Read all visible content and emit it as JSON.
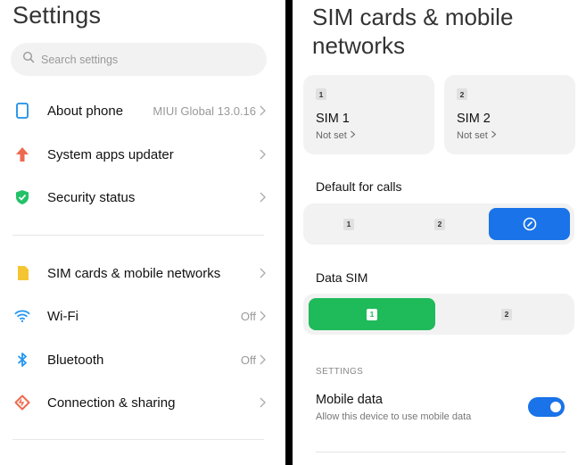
{
  "left": {
    "title": "Settings",
    "search": {
      "placeholder": "Search settings"
    },
    "items": [
      {
        "label": "About phone",
        "value": "MIUI Global 13.0.16",
        "icon": "phone-icon"
      },
      {
        "label": "System apps updater",
        "value": "",
        "icon": "arrow-up-icon"
      },
      {
        "label": "Security status",
        "value": "",
        "icon": "shield-check-icon"
      },
      {
        "label": "SIM cards & mobile networks",
        "value": "",
        "icon": "sim-card-icon"
      },
      {
        "label": "Wi-Fi",
        "value": "Off",
        "icon": "wifi-icon"
      },
      {
        "label": "Bluetooth",
        "value": "Off",
        "icon": "bluetooth-icon"
      },
      {
        "label": "Connection & sharing",
        "value": "",
        "icon": "connection-sharing-icon"
      }
    ]
  },
  "right": {
    "title": "SIM cards & mobile networks",
    "sims": [
      {
        "badge": "1",
        "name": "SIM 1",
        "status": "Not set"
      },
      {
        "badge": "2",
        "name": "SIM 2",
        "status": "Not set"
      }
    ],
    "default_calls": {
      "label": "Default for calls",
      "options": [
        "1",
        "2"
      ],
      "selected": "ask-every-time"
    },
    "data_sim": {
      "label": "Data SIM",
      "options": [
        "1",
        "2"
      ],
      "selected": "1"
    },
    "section_header": "SETTINGS",
    "mobile_data": {
      "title": "Mobile data",
      "subtitle": "Allow this device to use mobile data",
      "enabled": true
    }
  },
  "colors": {
    "accent_blue": "#1a73e8",
    "accent_green": "#1fba5a",
    "row_bg": "#f2f2f2"
  }
}
